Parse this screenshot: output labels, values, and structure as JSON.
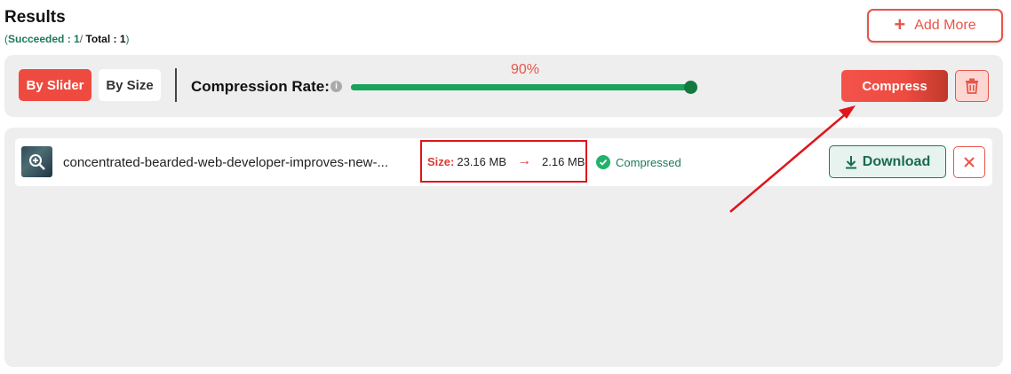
{
  "header": {
    "title": "Results",
    "stats": {
      "open": "(",
      "succeeded_label": "Succeeded : 1",
      "separator": "/",
      "total_label": " Total : 1",
      "close": ")"
    },
    "add_more_label": "Add More"
  },
  "toolbar": {
    "tabs": [
      {
        "label": "By Slider",
        "active": true
      },
      {
        "label": "By Size",
        "active": false
      }
    ],
    "compression_label": "Compression Rate:",
    "compression_rate": "90%",
    "slider_value_percent": 90,
    "compress_label": "Compress",
    "icons": {
      "info": "info-icon",
      "trash": "trash-icon"
    }
  },
  "results": {
    "files": [
      {
        "name": "concentrated-bearded-web-developer-improves-new-...",
        "size_label": "Size:",
        "original_size": "23.16 MB",
        "compressed_size": "2.16 MB",
        "status": "Compressed",
        "download_label": "Download"
      }
    ]
  },
  "colors": {
    "accent": "#ee4a40",
    "success": "#19a35a",
    "success_text": "#1a7a5a",
    "annotation": "#e0141a"
  }
}
